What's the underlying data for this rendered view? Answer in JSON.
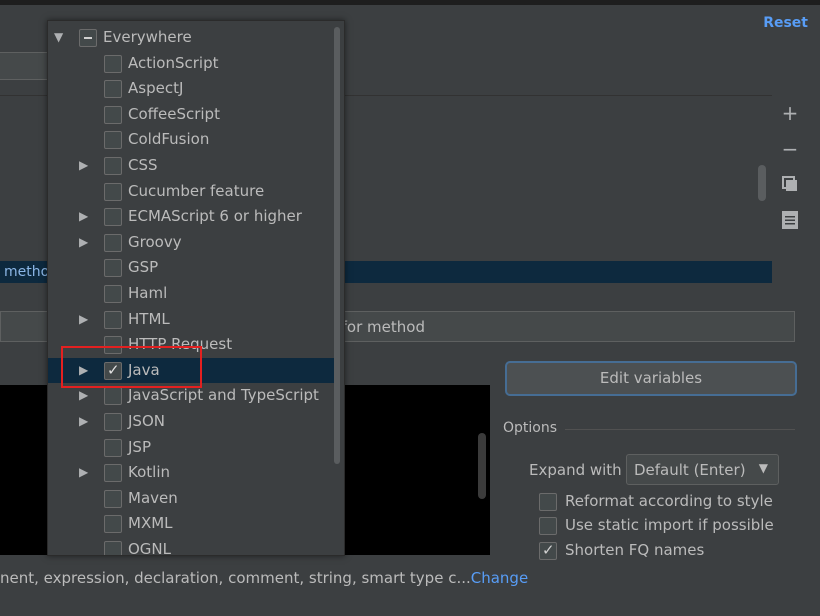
{
  "header": {
    "reset_label": "Reset"
  },
  "templates_list": {
    "selected_row_text": "metho"
  },
  "side_tools": {
    "add_icon": "plus-icon",
    "remove_icon": "minus-icon",
    "copy_icon": "copy-icon",
    "restore_icon": "list-icon"
  },
  "description": {
    "value": "t for method"
  },
  "edit_variables_label": "Edit variables",
  "options": {
    "title": "Options",
    "expand_label": "Expand with",
    "expand_value": "Default (Enter)",
    "checkboxes": [
      {
        "label": "Reformat according to style",
        "checked": false
      },
      {
        "label": "Use static import if possible",
        "checked": false
      },
      {
        "label": "Shorten FQ names",
        "checked": true
      }
    ]
  },
  "applicable": {
    "text": "nent, expression, declaration, comment, string, smart type c...",
    "change_label": "Change"
  },
  "context_tree": {
    "root": {
      "label": "Everywhere",
      "state": "partial"
    },
    "items": [
      {
        "label": "ActionScript",
        "expandable": false,
        "checked": false
      },
      {
        "label": "AspectJ",
        "expandable": false,
        "checked": false
      },
      {
        "label": "CoffeeScript",
        "expandable": false,
        "checked": false
      },
      {
        "label": "ColdFusion",
        "expandable": false,
        "checked": false
      },
      {
        "label": "CSS",
        "expandable": true,
        "checked": false
      },
      {
        "label": "Cucumber feature",
        "expandable": false,
        "checked": false
      },
      {
        "label": "ECMAScript 6 or higher",
        "expandable": true,
        "checked": false
      },
      {
        "label": "Groovy",
        "expandable": true,
        "checked": false
      },
      {
        "label": "GSP",
        "expandable": false,
        "checked": false
      },
      {
        "label": "Haml",
        "expandable": false,
        "checked": false
      },
      {
        "label": "HTML",
        "expandable": true,
        "checked": false
      },
      {
        "label": "HTTP Request",
        "expandable": false,
        "checked": false
      },
      {
        "label": "Java",
        "expandable": true,
        "checked": true,
        "selected": true
      },
      {
        "label": "JavaScript and TypeScript",
        "expandable": true,
        "checked": false
      },
      {
        "label": "JSON",
        "expandable": true,
        "checked": false
      },
      {
        "label": "JSP",
        "expandable": false,
        "checked": false
      },
      {
        "label": "Kotlin",
        "expandable": true,
        "checked": false
      },
      {
        "label": "Maven",
        "expandable": false,
        "checked": false
      },
      {
        "label": "MXML",
        "expandable": false,
        "checked": false
      },
      {
        "label": "OGNL",
        "expandable": false,
        "checked": false
      }
    ]
  }
}
